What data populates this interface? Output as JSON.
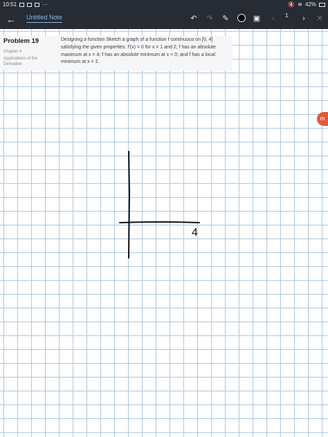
{
  "status_bar": {
    "time": "10:51",
    "more": "···",
    "battery": "42%"
  },
  "app_bar": {
    "note_title": "Untitled Note",
    "page_number": "1",
    "pen_color": "#000000",
    "icons": [
      "back-arrow",
      "undo",
      "redo",
      "pen",
      "color-picker",
      "image",
      "previous-page",
      "next-page",
      "close-edit"
    ]
  },
  "problem": {
    "title": "Problem 19",
    "chapter": "Chapter 4",
    "section": "Applications of the Derivative",
    "text": "Designing a function Sketch a graph of a function f continuous on [0, 4] satisfying the given properties. f′(x) = 0 for x = 1 and 2; f has an absolute maximum at x = 4; f has an absolute minimum at x = 0; and f has a local minimum at x = 2."
  },
  "sketch": {
    "axis_label": "4"
  },
  "side_badge": {
    "label": "m"
  }
}
